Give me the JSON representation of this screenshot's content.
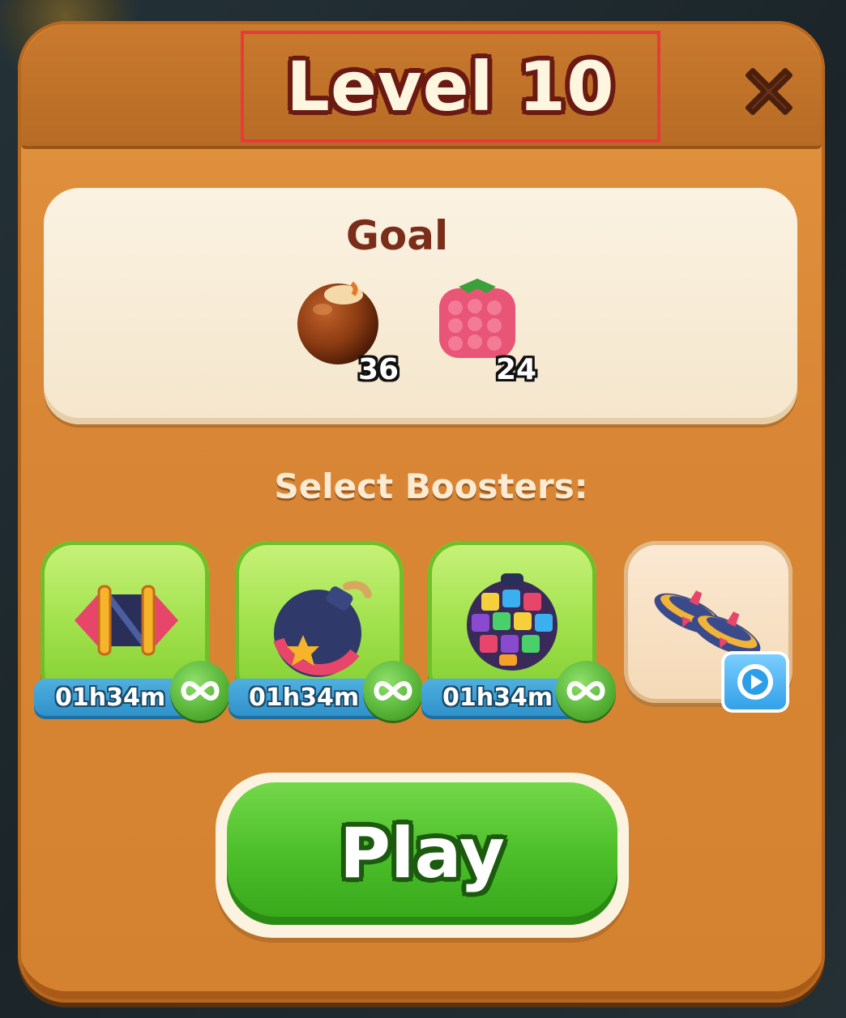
{
  "dialog": {
    "title": "Level 10",
    "close_icon": "close-icon"
  },
  "goal": {
    "title": "Goal",
    "items": [
      {
        "icon": "chestnut-icon",
        "count": "36"
      },
      {
        "icon": "raspberry-icon",
        "count": "24"
      }
    ]
  },
  "boosters": {
    "label": "Select Boosters:",
    "items": [
      {
        "icon": "rocket-booster-icon",
        "timer": "01h34m",
        "badge": "infinity-icon",
        "state": "active"
      },
      {
        "icon": "bomb-booster-icon",
        "timer": "01h34m",
        "badge": "infinity-icon",
        "state": "active"
      },
      {
        "icon": "color-ball-booster-icon",
        "timer": "01h34m",
        "badge": "infinity-icon",
        "state": "active"
      },
      {
        "icon": "spinning-top-booster-icon",
        "badge": "video-icon",
        "state": "locked"
      }
    ]
  },
  "play": {
    "label": "Play"
  },
  "colors": {
    "panel": "#d98736",
    "title_outline": "#6a1a12",
    "play_green": "#4cbf2a",
    "booster_green": "#9fe04a",
    "highlight_red": "#e83a3a"
  }
}
